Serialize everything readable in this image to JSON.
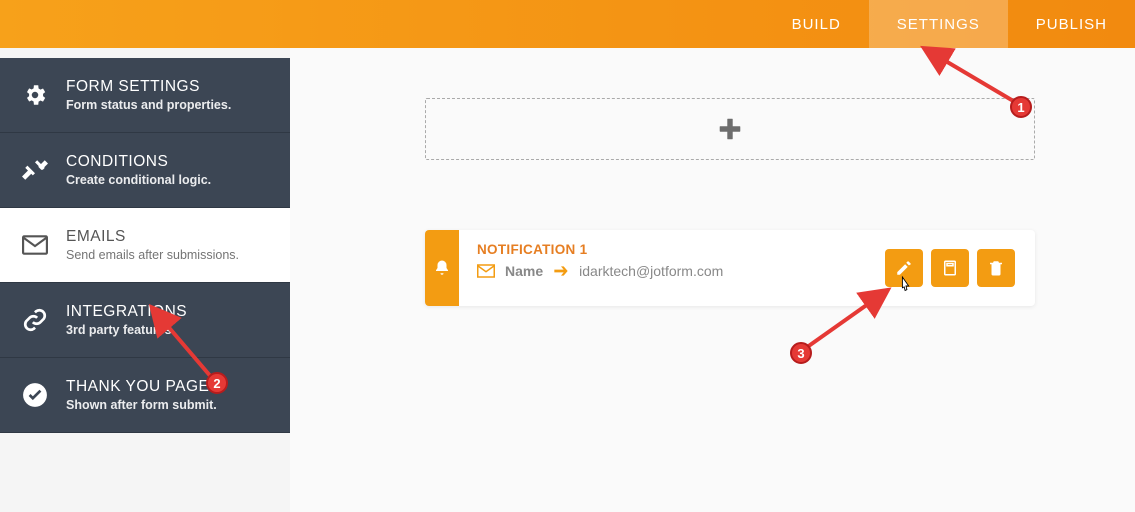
{
  "topnav": {
    "build": "BUILD",
    "settings": "SETTINGS",
    "publish": "PUBLISH"
  },
  "sidebar": {
    "form_settings": {
      "title": "FORM SETTINGS",
      "sub": "Form status and properties."
    },
    "conditions": {
      "title": "CONDITIONS",
      "sub": "Create conditional logic."
    },
    "emails": {
      "title": "EMAILS",
      "sub": "Send emails after submissions."
    },
    "integrations": {
      "title": "INTEGRATIONS",
      "sub": "3rd party features."
    },
    "thank_you": {
      "title": "THANK YOU PAGE",
      "sub": "Shown after form submit."
    }
  },
  "notification": {
    "title": "NOTIFICATION 1",
    "name_label": "Name",
    "recipient": "idarktech@jotform.com"
  },
  "annotations": {
    "b1": "1",
    "b2": "2",
    "b3": "3"
  }
}
